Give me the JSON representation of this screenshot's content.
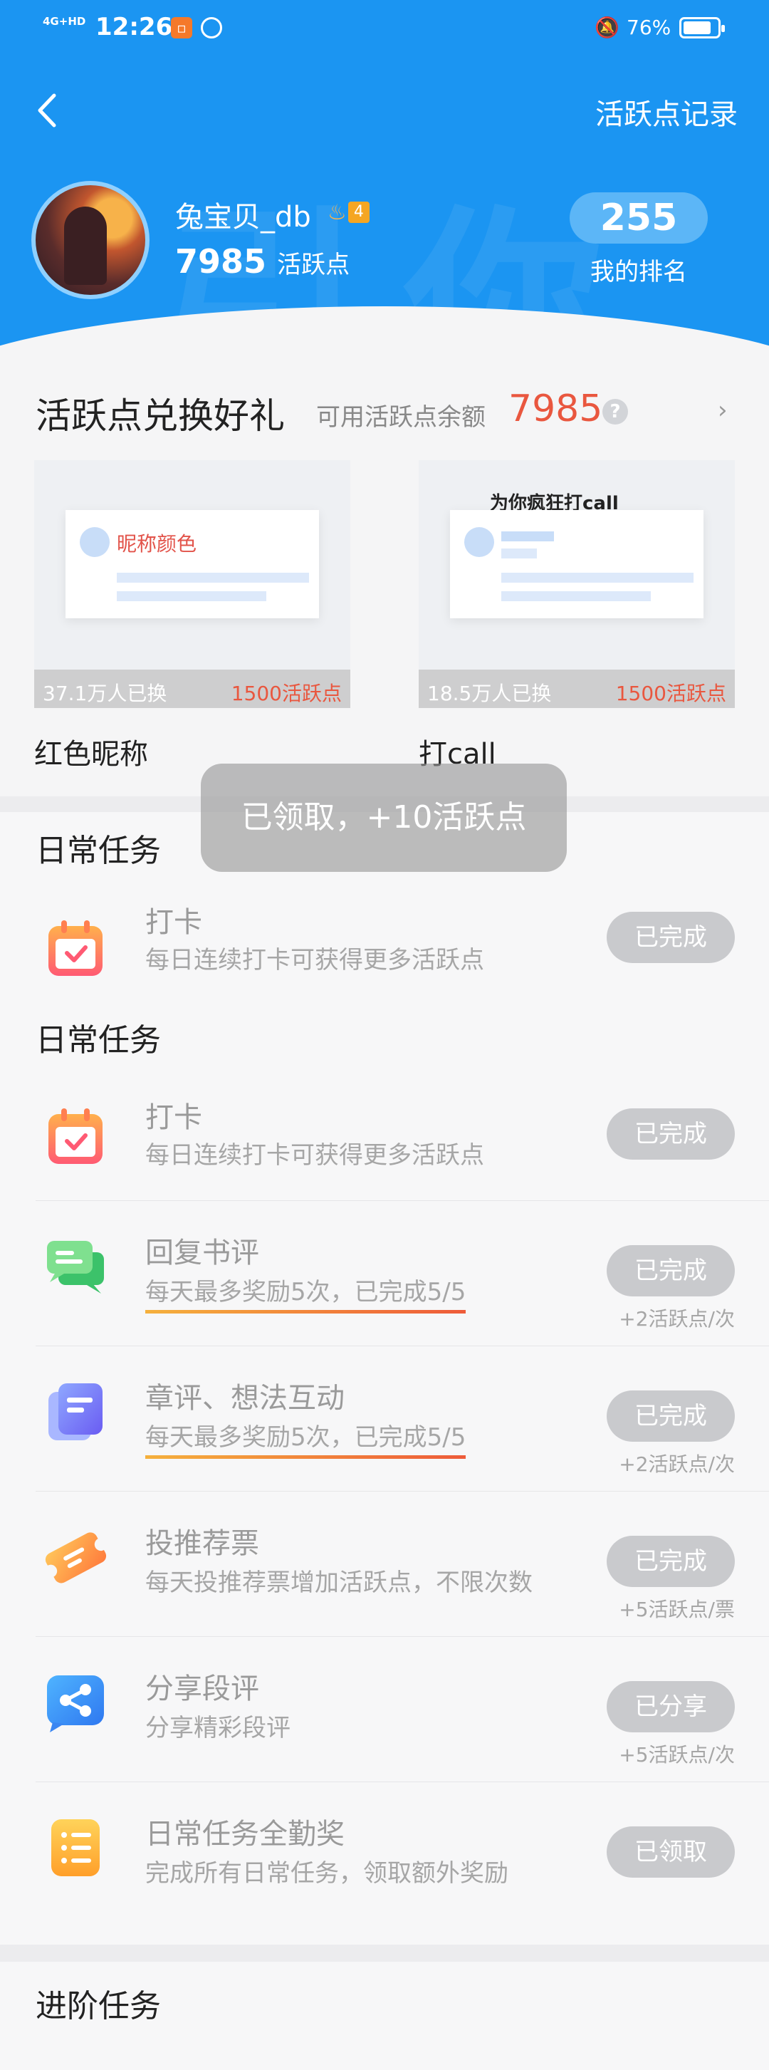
{
  "status_bar": {
    "network": "4G+HD",
    "time": "12:26",
    "battery": "76%"
  },
  "header": {
    "records_link": "活跃点记录",
    "username": "兔宝贝_db",
    "level": "4",
    "points": "7985",
    "points_unit": "活跃点",
    "rank": "255",
    "rank_label": "我的排名"
  },
  "exchange": {
    "title": "活跃点兑换好礼",
    "balance_label": "可用活跃点余额",
    "balance_value": "7985",
    "help": "?",
    "rewards": [
      {
        "name": "红色昵称",
        "preview_text": "昵称颜色",
        "exchanged": "37.1万人已换",
        "cost": "1500活跃点"
      },
      {
        "name": "打call",
        "preview_text": "为你疯狂打call",
        "exchanged": "18.5万人已换",
        "cost": "1500活跃点"
      }
    ]
  },
  "toast": "已领取，+10活跃点",
  "daily": {
    "title": "日常任务",
    "title_repeat": "日常任务",
    "tasks": [
      {
        "name": "打卡",
        "desc": "每日连续打卡可获得更多活跃点",
        "button": "已完成",
        "bonus": "",
        "icon": "calendar-check-icon"
      },
      {
        "name": "打卡",
        "desc": "每日连续打卡可获得更多活跃点",
        "button": "已完成",
        "bonus": "",
        "icon": "calendar-check-icon"
      },
      {
        "name": "回复书评",
        "desc": "每天最多奖励5次，已完成5/5",
        "button": "已完成",
        "bonus": "+2活跃点/次",
        "icon": "chat-bubbles-icon"
      },
      {
        "name": "章评、想法互动",
        "desc": "每天最多奖励5次，已完成5/5",
        "button": "已完成",
        "bonus": "+2活跃点/次",
        "icon": "document-icon"
      },
      {
        "name": "投推荐票",
        "desc": "每天投推荐票增加活跃点，不限次数",
        "button": "已完成",
        "bonus": "+5活跃点/票",
        "icon": "ticket-icon"
      },
      {
        "name": "分享段评",
        "desc": "分享精彩段评",
        "button": "已分享",
        "bonus": "+5活跃点/次",
        "icon": "share-icon"
      },
      {
        "name": "日常任务全勤奖",
        "desc": "完成所有日常任务，领取额外奖励",
        "button": "已领取",
        "bonus": "",
        "icon": "list-icon"
      }
    ]
  },
  "advanced": {
    "title": "进阶任务"
  },
  "colors": {
    "header_blue": "#1b95f2",
    "accent_red": "#e9573f",
    "button_grey": "#c9cacd"
  }
}
